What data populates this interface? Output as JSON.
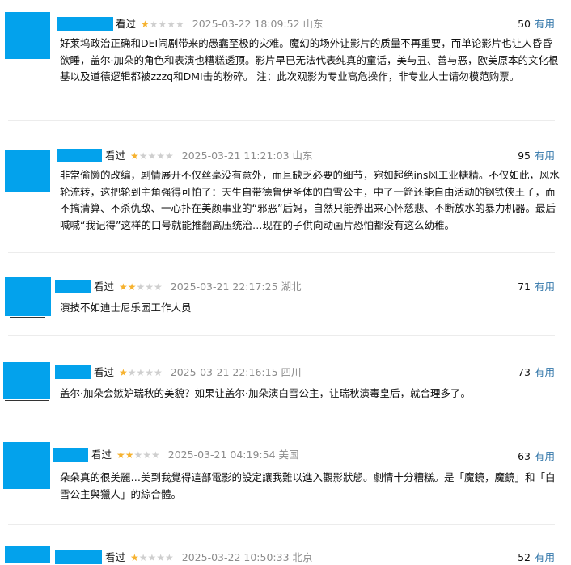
{
  "reviews": [
    {
      "status": "看过",
      "rating": 1,
      "time": "2025-03-22 18:09:52",
      "location": "山东",
      "votes": "50",
      "useful_label": "有用",
      "text": "好莱坞政治正确和DEI闹剧带来的愚蠢至极的灾难。魔幻的场外让影片的质量不再重要，而单论影片也让人昏昏欲睡，盖尔·加朵的角色和表演也糟糕透顶。影片早已无法代表纯真的童话，美与丑、善与恶，欧美原本的文化根基以及道德逻辑都被zzzq和DMI击的粉碎。 注：此次观影为专业高危操作，非专业人士请勿模范购票。"
    },
    {
      "status": "看过",
      "rating": 1,
      "time": "2025-03-21 11:21:03",
      "location": "山东",
      "votes": "95",
      "useful_label": "有用",
      "text": "非常偷懒的改编，剧情展开不仅丝毫没有意外，而且缺乏必要的细节，宛如超绝ins风工业糖精。不仅如此，风水轮流转，这把轮到主角强得可怕了：天生自带德鲁伊圣体的白雪公主，中了一箭还能自由活动的钢铁侠王子，而不搞清算、不杀仇敌、一心扑在美颜事业的“邪恶”后妈，自然只能养出来心怀慈悲、不断放水的暴力机器。最后喊喊“我记得”这样的口号就能推翻高压统治…现在的子供向动画片恐怕都没有这么幼稚。"
    },
    {
      "status": "看过",
      "rating": 2,
      "time": "2025-03-21 22:17:25",
      "location": "湖北",
      "votes": "71",
      "useful_label": "有用",
      "text": "演技不如迪士尼乐园工作人员"
    },
    {
      "status": "看过",
      "rating": 1,
      "time": "2025-03-21 22:16:15",
      "location": "四川",
      "votes": "73",
      "useful_label": "有用",
      "text": "盖尔·加朵会嫉妒瑞秋的美貌？如果让盖尔·加朵演白雪公主，让瑞秋演毒皇后，就合理多了。"
    },
    {
      "status": "看过",
      "rating": 2,
      "time": "2025-03-21 04:19:54",
      "location": "美国",
      "votes": "63",
      "useful_label": "有用",
      "text": "朵朵真的很美麗…美到我覺得這部電影的設定讓我難以進入觀影狀態。劇情十分糟糕。是「魔鏡，魔鏡」和「白雪公主與獵人」的綜合體。"
    },
    {
      "status": "看过",
      "rating": 1,
      "time": "2025-03-22 10:50:33",
      "location": "北京",
      "votes": "52",
      "useful_label": "有用",
      "text": ""
    }
  ],
  "colors": {
    "avatar": "#03a2ec",
    "star_on": "#f6b22f",
    "star_off": "#cfcfcf",
    "useful": "#3377aa",
    "time": "#8c8c8c"
  },
  "icons": {
    "star": "star-icon"
  }
}
